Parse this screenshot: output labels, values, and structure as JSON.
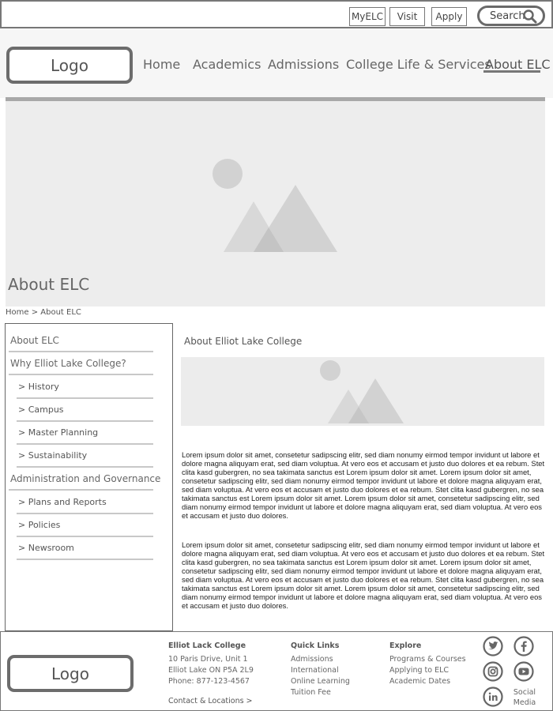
{
  "topbar": {
    "links": [
      "MyELC",
      "Visit",
      "Apply"
    ],
    "search_label": "Search"
  },
  "header": {
    "logo": "Logo",
    "nav": [
      "Home",
      "Academics",
      "Admissions",
      "College Life & Services",
      "About ELC"
    ],
    "active_nav": "About ELC"
  },
  "hero": {
    "title": "About ELC"
  },
  "breadcrumb": "Home > About ELC",
  "sidebar": {
    "items": [
      {
        "label": "About ELC",
        "type": "head"
      },
      {
        "label": "Why Elliot Lake College?",
        "type": "head"
      },
      {
        "label": "> History",
        "type": "sub"
      },
      {
        "label": "> Campus",
        "type": "sub"
      },
      {
        "label": "> Master Planning",
        "type": "sub"
      },
      {
        "label": "> Sustainability",
        "type": "sub"
      },
      {
        "label": "Administration and Governance",
        "type": "head"
      },
      {
        "label": "> Plans and Reports",
        "type": "sub"
      },
      {
        "label": "> Policies",
        "type": "sub"
      },
      {
        "label": "> Newsroom",
        "type": "sub"
      }
    ]
  },
  "main": {
    "title": "About Elliot Lake College",
    "paragraphs": [
      "Lorem ipsum dolor sit amet, consetetur sadipscing elitr, sed diam nonumy eirmod tempor invidunt ut labore et dolore magna aliquyam erat, sed diam voluptua. At vero eos et accusam et justo duo dolores et ea rebum. Stet clita kasd gubergren, no sea takimata sanctus est Lorem ipsum dolor sit amet. Lorem ipsum dolor sit amet, consetetur sadipscing elitr, sed diam nonumy eirmod tempor invidunt ut labore et dolore magna aliquyam erat, sed diam voluptua. At vero eos et accusam et justo duo dolores et ea rebum. Stet clita kasd gubergren, no sea takimata sanctus est Lorem ipsum dolor sit amet. Lorem ipsum dolor sit amet, consetetur sadipscing elitr, sed diam nonumy eirmod tempor invidunt ut labore et dolore magna aliquyam erat, sed diam voluptua. At vero eos et accusam et justo duo dolores.",
      "Lorem ipsum dolor sit amet, consetetur sadipscing elitr, sed diam nonumy eirmod tempor invidunt ut labore et dolore magna aliquyam erat, sed diam voluptua. At vero eos et accusam et justo duo dolores et ea rebum. Stet clita kasd gubergren, no sea takimata sanctus est Lorem ipsum dolor sit amet. Lorem ipsum dolor sit amet, consetetur sadipscing elitr, sed diam nonumy eirmod tempor invidunt ut labore et dolore magna aliquyam erat, sed diam voluptua. At vero eos et accusam et justo duo dolores et ea rebum. Stet clita kasd gubergren, no sea takimata sanctus est Lorem ipsum dolor sit amet. Lorem ipsum dolor sit amet, consetetur sadipscing elitr, sed diam nonumy eirmod tempor invidunt ut labore et dolore magna aliquyam erat, sed diam voluptua. At vero eos et accusam et justo duo dolores."
    ]
  },
  "footer": {
    "logo": "Logo",
    "college": {
      "name": "Elliot Lack College",
      "address1": "10 Paris Drive, Unit 1",
      "address2": "Elliot Lake ON P5A 2L9",
      "phone": "Phone: 877-123-4567",
      "contact_link": "Contact & Locations >"
    },
    "quick_links": {
      "title": "Quick Links",
      "items": [
        "Admissions",
        "International",
        "Online Learning",
        "Tuition Fee"
      ]
    },
    "explore": {
      "title": "Explore",
      "items": [
        "Programs & Courses",
        "Applying to ELC",
        "Academic Dates"
      ]
    },
    "social": {
      "icons": [
        "twitter-icon",
        "facebook-icon",
        "instagram-icon",
        "youtube-icon",
        "linkedin-icon"
      ],
      "label_line1": "Social",
      "label_line2": "Media"
    }
  }
}
